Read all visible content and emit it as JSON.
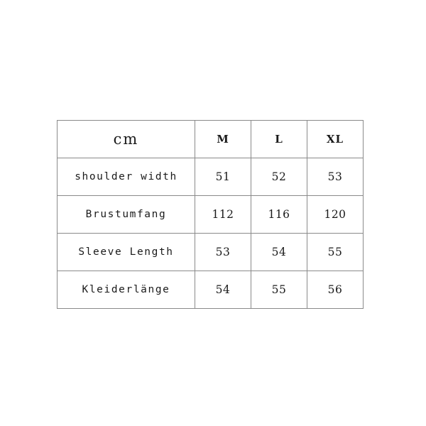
{
  "table": {
    "unit_label": "cm",
    "size_columns": [
      "M",
      "L",
      "XL"
    ],
    "rows": [
      {
        "label": "shoulder width",
        "values": [
          "51",
          "52",
          "53"
        ]
      },
      {
        "label": "Brustumfang",
        "values": [
          "112",
          "116",
          "120"
        ]
      },
      {
        "label": "Sleeve Length",
        "values": [
          "53",
          "54",
          "55"
        ]
      },
      {
        "label": "Kleiderlänge",
        "values": [
          "54",
          "55",
          "56"
        ]
      }
    ]
  },
  "colors": {
    "background": "#ffffff",
    "border": "#8a8a8a",
    "text": "#1a1a1a"
  }
}
